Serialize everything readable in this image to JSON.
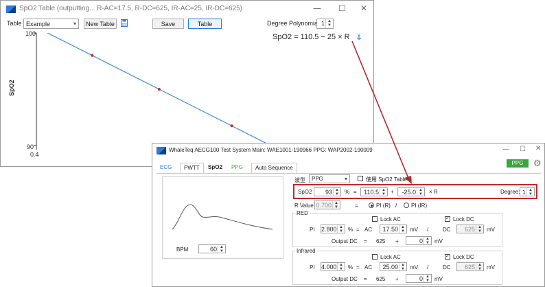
{
  "table_window": {
    "title": "SpO2 Table (outputting... R-AC=17.5, R-DC=625, IR-AC=25, IR-DC=625)",
    "controls": {
      "minimize": "—",
      "maximize": "☐",
      "close": "✕"
    },
    "toolbar": {
      "table_label": "Table",
      "table_value": "Example",
      "new_table": "New Table",
      "save": "Save",
      "table_button": "Table",
      "degree_label": "Degree Polynomial:",
      "degree_value": "1"
    },
    "chart_data": {
      "type": "line",
      "ylabel": "SpO2",
      "xlabel": "",
      "xlim": [
        0.4,
        1.0
      ],
      "ylim": [
        90,
        100
      ],
      "yticks": [
        "100",
        "90"
      ],
      "xticks": [
        "0.4"
      ],
      "equation": "SpO2 = 110.5 − 25 × R",
      "line": {
        "x": [
          0.4,
          1.0
        ],
        "y": [
          100.5,
          85.5
        ]
      },
      "points": {
        "x": [
          0.5,
          0.62,
          0.75
        ],
        "y": [
          98.0,
          95.0,
          91.75
        ]
      },
      "colors": {
        "line": "#3b8ad9",
        "points": "#d62728"
      }
    }
  },
  "test_window": {
    "title": "WhaleTeq AECG100 Test System   Main: WAE1001-190966  PPG: WAP2002-190009",
    "controls": {
      "minimize": "—",
      "maximize": "☐",
      "close": "✕"
    },
    "ppg_badge": "PPG",
    "tabs": [
      "ECG",
      "PWTT",
      "SpO2",
      "PPG",
      "Auto Sequence"
    ],
    "bpm_label": "BPM",
    "bpm_value": "60",
    "type_label": "波型",
    "type_value": "PPG",
    "use_table_label": "使用 SpO2 Table",
    "formula": {
      "label": "SpO2",
      "value": "93",
      "percent": "%",
      "eq": "=",
      "a": "110.5",
      "plus": "+",
      "b": "-25.0",
      "times_r": "× R",
      "degree_label": "Degree:",
      "degree_value": "1"
    },
    "r_value": {
      "label": "R Value",
      "value": "0.700",
      "eq": "=",
      "opt1": "PI (R)",
      "slash": "/",
      "opt2": "PI (IR)"
    },
    "red": {
      "legend": "RED",
      "lock_ac": "Lock AC",
      "lock_dc": "Lock DC",
      "pi_label": "PI",
      "pi_value": "2.800",
      "pct": "%",
      "eq": "=",
      "ac_label": "AC",
      "ac_value": "17.50",
      "ac_unit": "mV",
      "slash": "/",
      "dc_label": "DC",
      "dc_value": "625",
      "dc_unit": "mV",
      "out_label": "Output DC",
      "out_eq": "=",
      "out_base": "625",
      "out_plus": "+",
      "out_value": "0",
      "out_unit": "mV"
    },
    "infrared": {
      "legend": "Infrared",
      "lock_ac": "Lock AC",
      "lock_dc": "Lock DC",
      "pi_label": "PI",
      "pi_value": "4.000",
      "pct": "%",
      "eq": "=",
      "ac_label": "AC",
      "ac_value": "25.00",
      "ac_unit": "mV",
      "slash": "/",
      "dc_label": "DC",
      "dc_value": "625",
      "dc_unit": "mV",
      "out_label": "Output DC",
      "out_eq": "=",
      "out_base": "625",
      "out_plus": "+",
      "out_value": "0",
      "out_unit": "mV"
    },
    "colors": {
      "highlight": "#c0262d",
      "accent": "#2b7bd8",
      "ppg_green": "#3da53f",
      "arrow": "#b02a2a"
    }
  }
}
